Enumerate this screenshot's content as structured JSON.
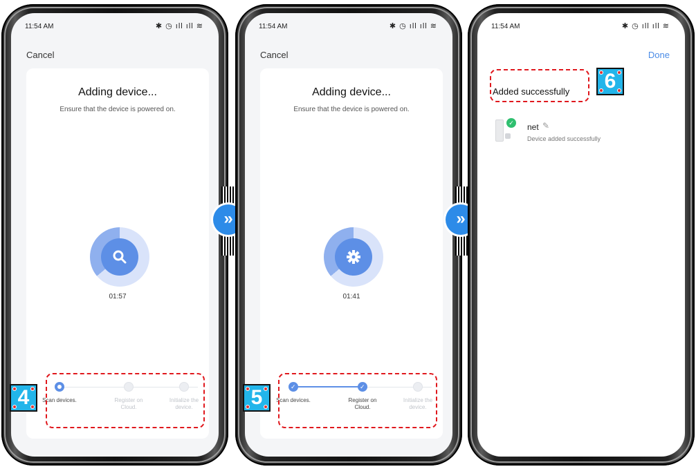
{
  "status_bar": {
    "time": "11:54 AM",
    "icons": "✱ ◷ ıll ıll ≋"
  },
  "panels": [
    {
      "cancel_label": "Cancel",
      "title": "Adding device...",
      "subtitle": "Ensure that the device is powered on.",
      "spinner_icon": "search-icon",
      "timer": "01:57",
      "steps": [
        {
          "label": "Scan devices.",
          "state": "active"
        },
        {
          "label": "Register on Cloud.",
          "state": "pending"
        },
        {
          "label": "Initialize the device.",
          "state": "pending"
        }
      ],
      "badge": "4"
    },
    {
      "cancel_label": "Cancel",
      "title": "Adding device...",
      "subtitle": "Ensure that the device is powered on.",
      "spinner_icon": "gear-icon",
      "timer": "01:41",
      "steps": [
        {
          "label": "Scan devices.",
          "state": "done"
        },
        {
          "label": "Register on Cloud.",
          "state": "done"
        },
        {
          "label": "Initialize the device.",
          "state": "pending"
        }
      ],
      "badge": "5"
    },
    {
      "done_label": "Done",
      "heading": "Added successfully",
      "device": {
        "name": "net",
        "status": "Device added successfully"
      },
      "badge": "6"
    }
  ],
  "colors": {
    "accent": "#5d8fe6",
    "highlight": "#e0181d",
    "badge": "#22b5ea",
    "success": "#2fbf6f"
  }
}
